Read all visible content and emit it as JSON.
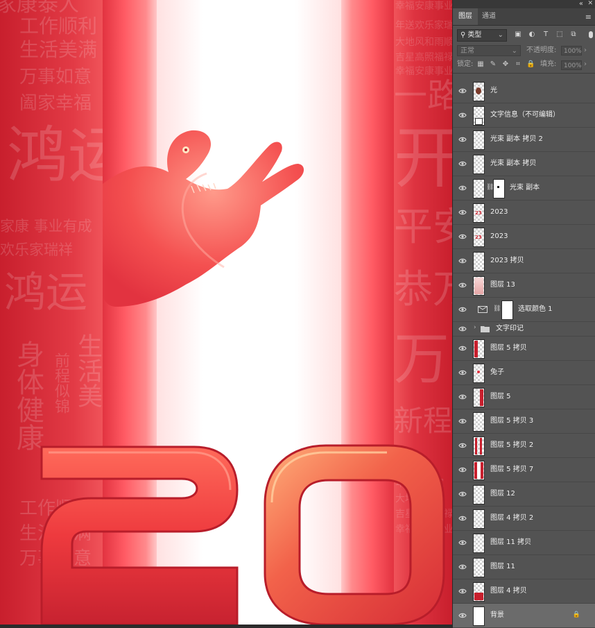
{
  "canvas": {
    "left_phrases": [
      "家康泰人",
      "工作顺利",
      "生活美满",
      "万事如意",
      "阖家幸福",
      "鸿运",
      "家康 事业有成",
      "欢乐家瑞祥",
      "鸿运",
      "身体健康",
      "前程似锦",
      "生活美",
      "工作顺利",
      "生活美满",
      "万事如意"
    ],
    "right_phrases": [
      "幸福安康事业",
      "年送欢乐家瑞",
      "大地风和雨顺",
      "吉星高照福禄",
      "幸福安康事业",
      "一路",
      "开",
      "平安",
      "恭万",
      "万",
      "新程",
      "年送欢乐家",
      "大地风和雨",
      "吉星高照福禄",
      "幸福安康事业"
    ],
    "digits": "20",
    "palette": {
      "red": "#e02f3a",
      "deep_red": "#c81f2d",
      "glow": "#ffffff"
    }
  },
  "panel": {
    "tabs": [
      {
        "label": "图层",
        "active": true
      },
      {
        "label": "通道",
        "active": false
      }
    ],
    "filter": {
      "label": "类型",
      "icons": [
        "image-filter-icon",
        "adjustment-filter-icon",
        "text-filter-icon",
        "shape-filter-icon",
        "smart-object-filter-icon"
      ]
    },
    "blend_mode": "正常",
    "opacity_label": "不透明度:",
    "opacity_value": "100%",
    "lock_label": "锁定:",
    "fill_label": "填充:",
    "fill_value": "100%",
    "layers": [
      {
        "name": "光",
        "thumb": "light",
        "visible": true
      },
      {
        "name": "文字信息（不可编辑）",
        "thumb": "text-doc",
        "visible": true
      },
      {
        "name": "光束 副本 拷贝 2",
        "thumb": "empty",
        "visible": true
      },
      {
        "name": "光束 副本 拷贝",
        "thumb": "empty",
        "visible": true
      },
      {
        "name": "光束 副本",
        "thumb": "mask",
        "visible": true
      },
      {
        "name": "2023",
        "thumb": "num",
        "visible": true
      },
      {
        "name": "2023",
        "thumb": "num",
        "visible": true
      },
      {
        "name": "2023 拷贝",
        "thumb": "empty",
        "visible": true
      },
      {
        "name": "图层 13",
        "thumb": "pink",
        "visible": true
      },
      {
        "name": "选取颜色 1",
        "thumb": "adjust",
        "visible": true
      },
      {
        "name": "文字印记",
        "thumb": "folder",
        "visible": true
      },
      {
        "name": "图层 5 拷贝",
        "thumb": "redbar",
        "visible": true
      },
      {
        "name": "兔子",
        "thumb": "rabbit",
        "visible": true
      },
      {
        "name": "图层 5",
        "thumb": "redbar-r",
        "visible": true
      },
      {
        "name": "图层 5 拷贝 3",
        "thumb": "empty",
        "visible": true
      },
      {
        "name": "图层 5 拷贝 2",
        "thumb": "bars",
        "visible": true
      },
      {
        "name": "图层 5 拷贝 7",
        "thumb": "bars2",
        "visible": true
      },
      {
        "name": "图层 12",
        "thumb": "empty",
        "visible": true
      },
      {
        "name": "图层 4 拷贝 2",
        "thumb": "empty",
        "visible": true
      },
      {
        "name": "图层 11 拷贝",
        "thumb": "empty",
        "visible": true
      },
      {
        "name": "图层 11",
        "thumb": "empty",
        "visible": true
      },
      {
        "name": "图层 4 拷贝",
        "thumb": "redbottom",
        "visible": true
      },
      {
        "name": "背景",
        "thumb": "white",
        "visible": true,
        "locked": true,
        "selected": true
      }
    ]
  }
}
